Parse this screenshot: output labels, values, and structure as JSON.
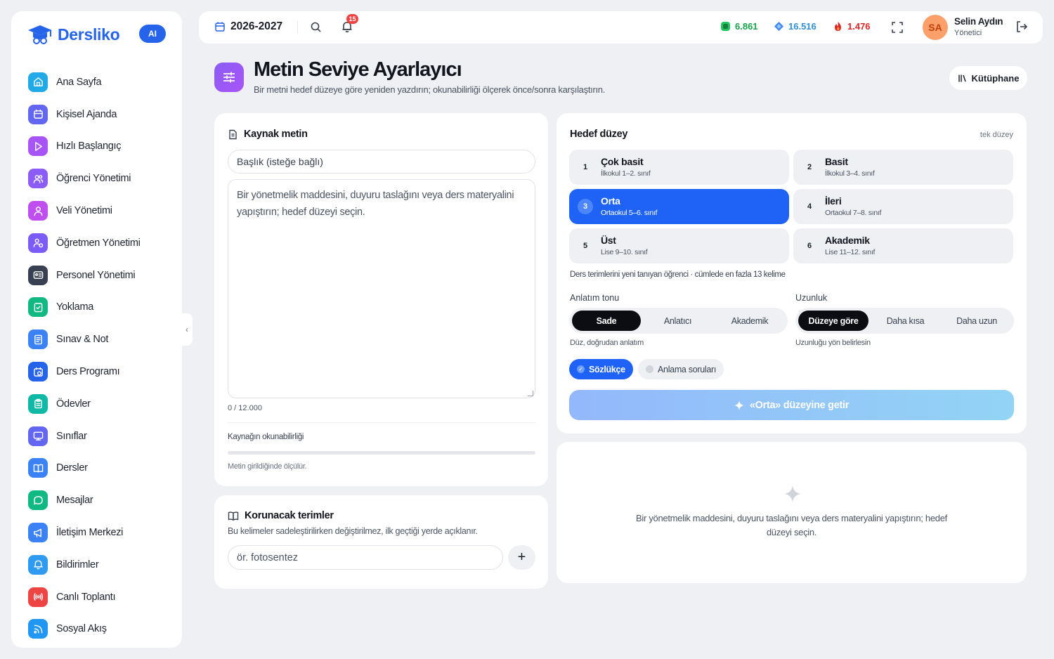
{
  "sidebar": {
    "logo": "Dersliko",
    "ai_badge": "AI",
    "items": [
      {
        "label": "Ana Sayfa",
        "icon": "home-icon",
        "color": "#22a9e8"
      },
      {
        "label": "Kişisel Ajanda",
        "icon": "calendar-icon",
        "color": "#6366f1"
      },
      {
        "label": "Hızlı Başlangıç",
        "icon": "play-icon",
        "color": "#a855f7"
      },
      {
        "label": "Öğrenci Yönetimi",
        "icon": "users-icon",
        "color": "#8b5cf6"
      },
      {
        "label": "Veli Yönetimi",
        "icon": "user-icon",
        "color": "#c04ff0"
      },
      {
        "label": "Öğretmen Yönetimi",
        "icon": "teacher-icon",
        "color": "#7c5cf6"
      },
      {
        "label": "Personel Yönetimi",
        "icon": "id-card-icon",
        "color": "#374151"
      },
      {
        "label": "Yoklama",
        "icon": "checklist-icon",
        "color": "#10b981"
      },
      {
        "label": "Sınav & Not",
        "icon": "exam-icon",
        "color": "#3b82f6"
      },
      {
        "label": "Ders Programı",
        "icon": "schedule-icon",
        "color": "#2563eb"
      },
      {
        "label": "Ödevler",
        "icon": "clipboard-icon",
        "color": "#10b9a6"
      },
      {
        "label": "Sınıflar",
        "icon": "monitor-icon",
        "color": "#6366f1"
      },
      {
        "label": "Dersler",
        "icon": "book-icon",
        "color": "#3b82f6"
      },
      {
        "label": "Mesajlar",
        "icon": "message-icon",
        "color": "#10b981"
      },
      {
        "label": "İletişim Merkezi",
        "icon": "megaphone-icon",
        "color": "#3b82f6"
      },
      {
        "label": "Bildirimler",
        "icon": "bell-icon",
        "color": "#2f9bf0"
      },
      {
        "label": "Canlı Toplantı",
        "icon": "broadcast-icon",
        "color": "#ef4444"
      },
      {
        "label": "Sosyal Akış",
        "icon": "rss-icon",
        "color": "#2196f3"
      }
    ]
  },
  "topbar": {
    "year": "2026-2027",
    "notifications": "15",
    "stats": [
      {
        "value": "6.861",
        "color": "#16a34a",
        "icon": "gem-green-icon"
      },
      {
        "value": "16.516",
        "color": "#2f8fd8",
        "icon": "gem-blue-icon"
      },
      {
        "value": "1.476",
        "color": "#dc2626",
        "icon": "fire-icon"
      }
    ],
    "avatar": "SA",
    "user_name": "Selin Aydın",
    "user_role": "Yönetici"
  },
  "header": {
    "title": "Metin Seviye Ayarlayıcı",
    "subtitle": "Bir metni hedef düzeye göre yeniden yazdırın; okunabilirliği ölçerek önce/sonra karşılaştırın.",
    "library_button": "Kütüphane"
  },
  "source": {
    "title": "Kaynak metin",
    "title_placeholder": "Başlık (isteğe bağlı)",
    "text_placeholder": "Bir yönetmelik maddesini, duyuru taslağını veya ders materyalini yapıştırın; hedef düzeyi seçin.",
    "char_count": "0 / 12.000",
    "readability_label": "Kaynağın okunabilirliği",
    "readability_hint": "Metin girildiğinde ölçülür."
  },
  "terms": {
    "title": "Korunacak terimler",
    "description": "Bu kelimeler sadeleştirilirken değiştirilmez, ilk geçtiği yerde açıklanır.",
    "placeholder": "ör. fotosentez",
    "add_label": "+"
  },
  "target": {
    "title": "Hedef düzey",
    "single_label": "tek düzey",
    "levels": [
      {
        "num": "1",
        "name": "Çok basit",
        "grade": "İlkokul 1–2. sınıf"
      },
      {
        "num": "2",
        "name": "Basit",
        "grade": "İlkokul 3–4. sınıf"
      },
      {
        "num": "3",
        "name": "Orta",
        "grade": "Ortaokul 5–6. sınıf"
      },
      {
        "num": "4",
        "name": "İleri",
        "grade": "Ortaokul 7–8. sınıf"
      },
      {
        "num": "5",
        "name": "Üst",
        "grade": "Lise 9–10. sınıf"
      },
      {
        "num": "6",
        "name": "Akademik",
        "grade": "Lise 11–12. sınıf"
      }
    ],
    "selected_level": "3",
    "level_description": "Ders terimlerini yeni tanıyan öğrenci · cümlede en fazla 13 kelime",
    "tone": {
      "label": "Anlatım tonu",
      "options": [
        "Sade",
        "Anlatıcı",
        "Akademik"
      ],
      "selected": "Sade",
      "hint": "Düz, doğrudan anlatım"
    },
    "length": {
      "label": "Uzunluk",
      "options": [
        "Düzeye göre",
        "Daha kısa",
        "Daha uzun"
      ],
      "selected": "Düzeye göre",
      "hint": "Uzunluğu yön belirlesin"
    },
    "chips": [
      {
        "label": "Sözlükçe",
        "on": true
      },
      {
        "label": "Anlama soruları",
        "on": false
      }
    ],
    "action_button": "«Orta» düzeyine getir"
  },
  "output": {
    "placeholder": "Bir yönetmelik maddesini, duyuru taslağını veya ders materyalini yapıştırın; hedef düzeyi seçin."
  }
}
